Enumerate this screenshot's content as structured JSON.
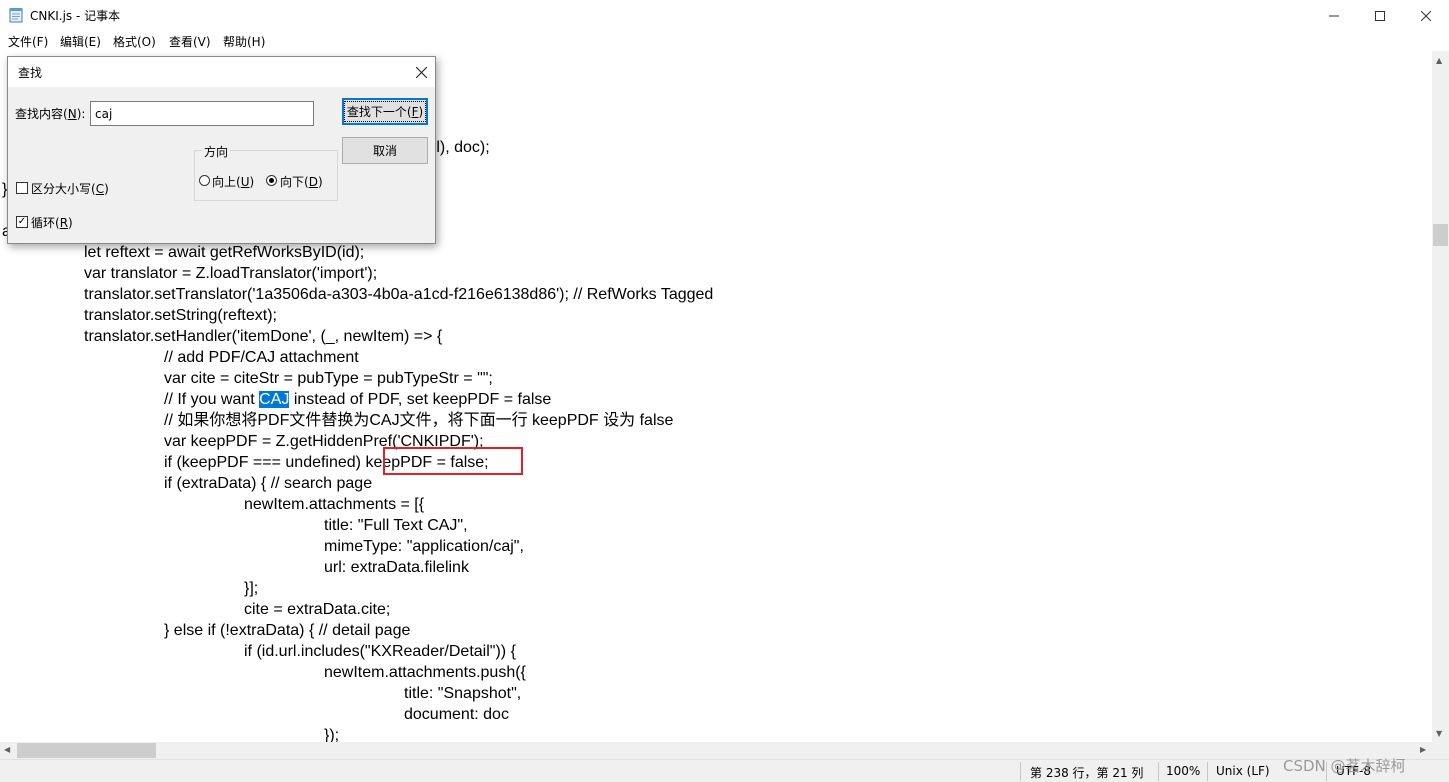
{
  "window": {
    "title": "CNKI.js - 记事本",
    "minimize_glyph": "—",
    "maximize_glyph": "☐",
    "close_glyph": "✕"
  },
  "menu": [
    {
      "label": "文件(F)"
    },
    {
      "label": "编辑(E)"
    },
    {
      "label": "格式(O)"
    },
    {
      "label": "查看(V)"
    },
    {
      "label": "帮助(H)"
    }
  ],
  "editor": {
    "lines": [
      {
        "before": "rl), doc);",
        "match": "",
        "after": ""
      },
      {
        "before": "}",
        "match": "",
        "after": ""
      },
      {
        "before": "a",
        "match": "",
        "after": ""
      },
      {
        "before": "let reftext = await getRefWorksByID(id);",
        "match": "",
        "after": ""
      },
      {
        "before": "var translator = Z.loadTranslator('import');",
        "match": "",
        "after": ""
      },
      {
        "before": "translator.setTranslator('1a3506da-a303-4b0a-a1cd-f216e6138d86'); // RefWorks Tagged",
        "match": "",
        "after": ""
      },
      {
        "before": "translator.setString(reftext);",
        "match": "",
        "after": ""
      },
      {
        "before": "translator.setHandler('itemDone', (_, newItem) => {",
        "match": "",
        "after": ""
      },
      {
        "before": "// add PDF/CAJ attachment",
        "match": "",
        "after": ""
      },
      {
        "before": "var cite = citeStr = pubType = pubTypeStr = \"\";",
        "match": "",
        "after": ""
      },
      {
        "before": "// If you want ",
        "match": "CAJ",
        "after": " instead of PDF, set keepPDF = false"
      },
      {
        "before": "// 如果你想将PDF文件替换为CAJ文件，将下面一行 keepPDF 设为 false",
        "match": "",
        "after": ""
      },
      {
        "before": "var keepPDF = Z.getHiddenPref('CNKIPDF');",
        "match": "",
        "after": ""
      },
      {
        "before": "if (keepPDF === undefined) keepPDF = false;",
        "match": "",
        "after": ""
      },
      {
        "before": "if (extraData) { // search page",
        "match": "",
        "after": ""
      },
      {
        "before": "newItem.attachments = [{",
        "match": "",
        "after": ""
      },
      {
        "before": "title: \"Full Text CAJ\",",
        "match": "",
        "after": ""
      },
      {
        "before": "mimeType: \"application/caj\",",
        "match": "",
        "after": ""
      },
      {
        "before": "url: extraData.filelink",
        "match": "",
        "after": ""
      },
      {
        "before": "}];",
        "match": "",
        "after": ""
      },
      {
        "before": "cite = extraData.cite;",
        "match": "",
        "after": ""
      },
      {
        "before": "} else if (!extraData) { // detail page",
        "match": "",
        "after": ""
      },
      {
        "before": "if (id.url.includes(\"KXReader/Detail\")) {",
        "match": "",
        "after": ""
      },
      {
        "before": "newItem.attachments.push({",
        "match": "",
        "after": ""
      },
      {
        "before": "title: \"Snapshot\",",
        "match": "",
        "after": ""
      },
      {
        "before": "document: doc",
        "match": "",
        "after": ""
      },
      {
        "before": "});",
        "match": "",
        "after": ""
      }
    ]
  },
  "scrollbar": {
    "up": "▲",
    "down": "▼",
    "left": "◀",
    "right": "▶"
  },
  "status": {
    "position": "第 238 行，第 21 列",
    "zoom": "100%",
    "line_ending": "Unix (LF)",
    "encoding": "UTF-8"
  },
  "watermark": "CSDN @茗木辞柯",
  "find_dialog": {
    "title": "查找",
    "close_glyph": "✕",
    "find_what_label": "查找内容",
    "find_what_key": "N",
    "search_value": "caj",
    "find_next_label": "查找下一个",
    "find_next_key": "F",
    "cancel_label": "取消",
    "direction_label": "方向",
    "up_label": "向上",
    "up_key": "U",
    "down_label": "向下",
    "down_key": "D",
    "direction_selected": "down",
    "match_case_label": "区分大小写",
    "match_case_key": "C",
    "match_case_checked": false,
    "wrap_label": "循环",
    "wrap_key": "R",
    "wrap_checked": true,
    "check_glyph": "✓"
  }
}
